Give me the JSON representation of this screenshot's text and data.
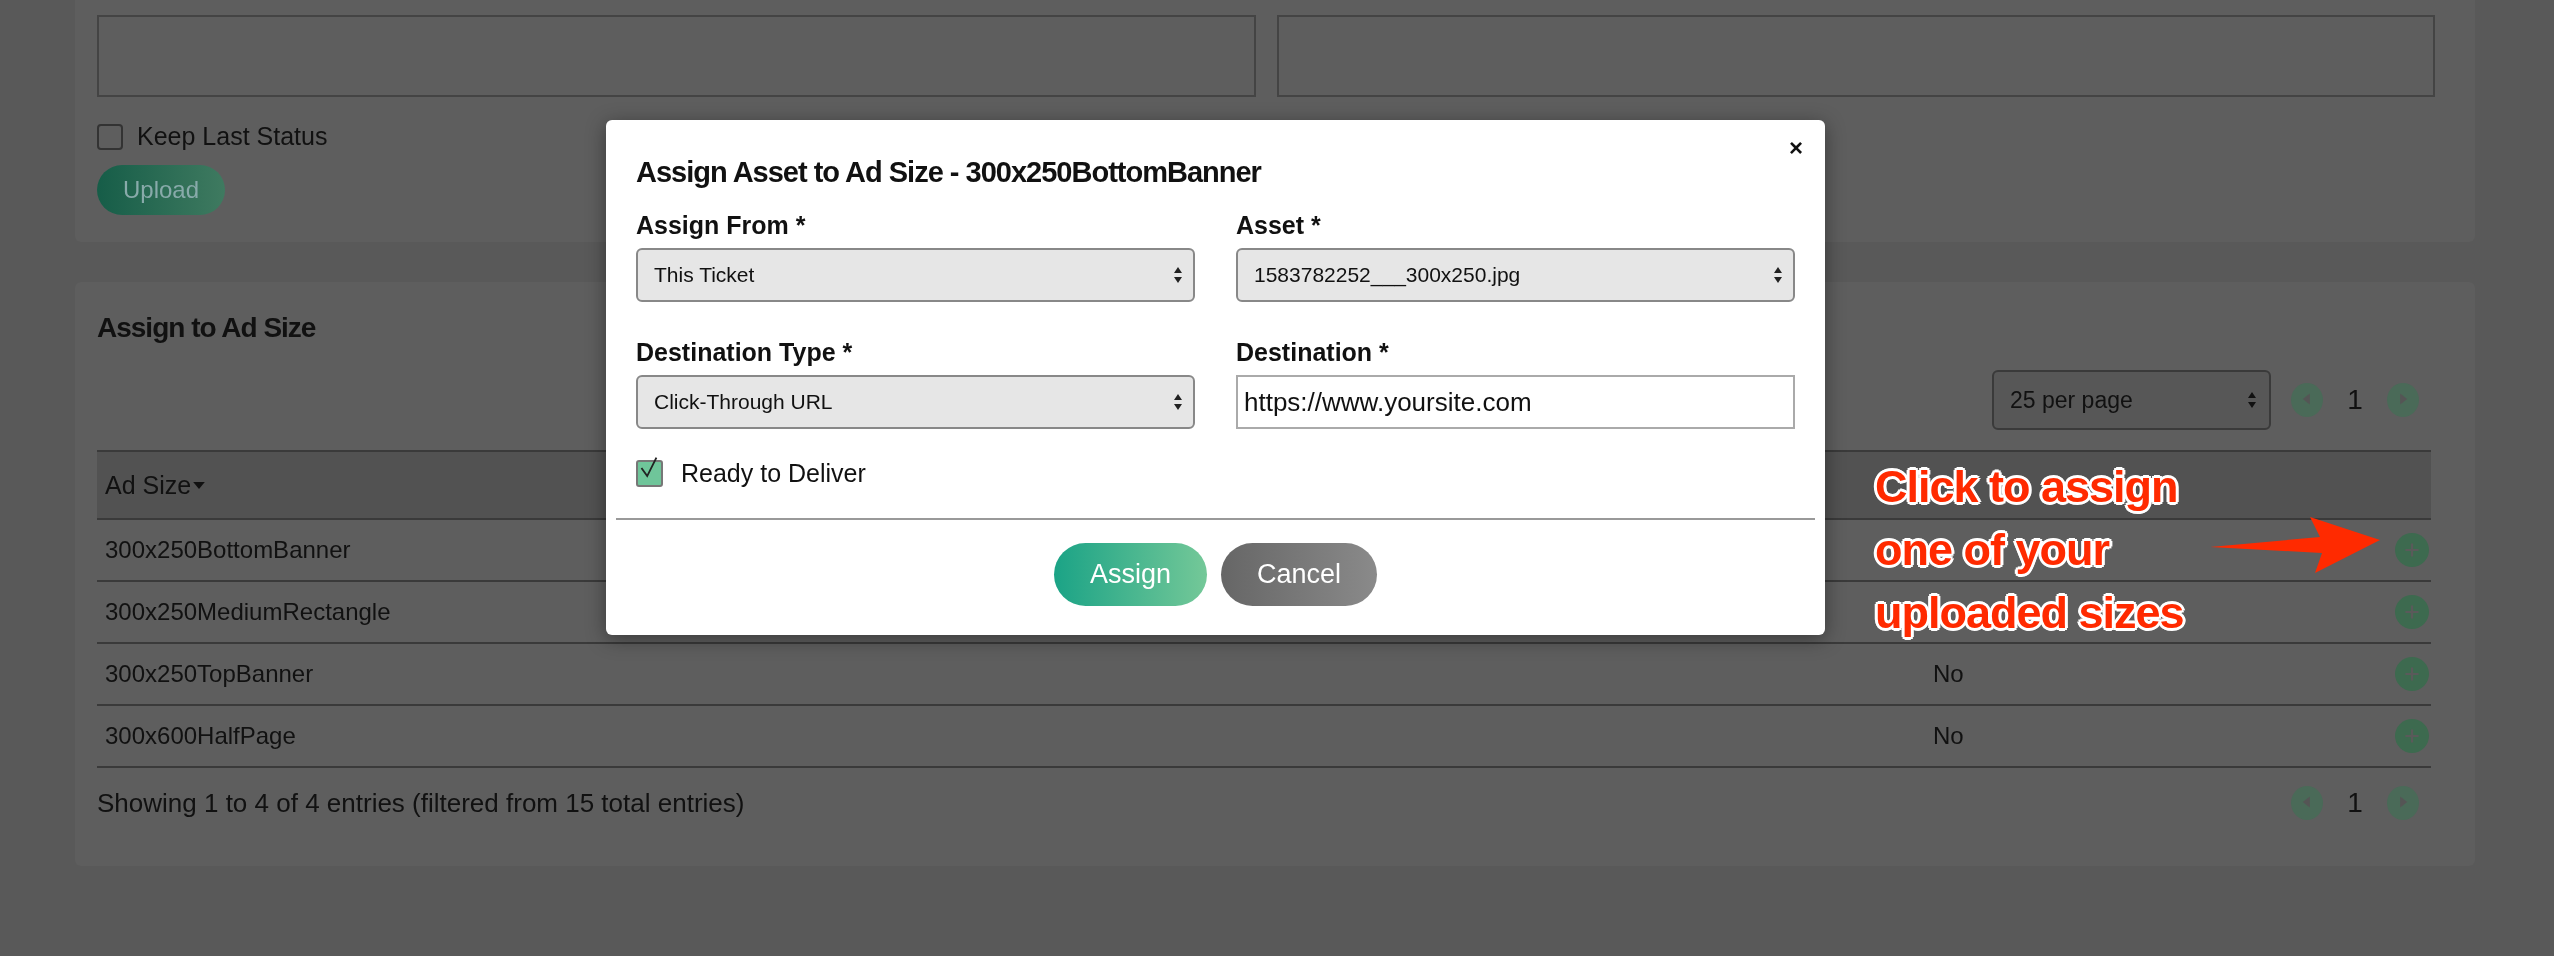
{
  "background_form": {
    "keep_last_status": {
      "label": "Keep Last Status",
      "checked": false
    },
    "upload_button": "Upload"
  },
  "assign_panel": {
    "title": "Assign to Ad Size",
    "page_size": "25 per page",
    "page": "1",
    "columns": [
      {
        "label": "Ad Size",
        "sorted": true
      }
    ],
    "rows": [
      {
        "ad_size": "300x250BottomBanner"
      },
      {
        "ad_size": "300x250MediumRectangle"
      },
      {
        "ad_size": "300x250TopBanner",
        "column_2": "No"
      },
      {
        "ad_size": "300x600HalfPage",
        "column_2": "No"
      }
    ],
    "info": "Showing 1 to 4 of 4 entries (filtered from 15 total entries)",
    "footer_page": "1"
  },
  "modal": {
    "title": "Assign Asset to Ad Size - 300x250BottomBanner",
    "close": "×",
    "fields": [
      {
        "label": "Assign From *",
        "kind": "select",
        "value": "This Ticket"
      },
      {
        "label": "Asset *",
        "kind": "select",
        "value": "1583782252___300x250.jpg"
      },
      {
        "label": "Destination Type *",
        "kind": "select",
        "value": "Click-Through URL"
      },
      {
        "label": "Destination *",
        "kind": "text",
        "value": "https://www.yoursite.com"
      }
    ],
    "ready": {
      "label": "Ready to Deliver",
      "checked": true
    },
    "buttons": [
      {
        "label": "Assign",
        "kind": "primary"
      },
      {
        "label": "Cancel",
        "kind": "secondary"
      }
    ]
  },
  "annotation": {
    "lines": [
      "Click to assign",
      "one of your",
      "uploaded sizes"
    ]
  }
}
